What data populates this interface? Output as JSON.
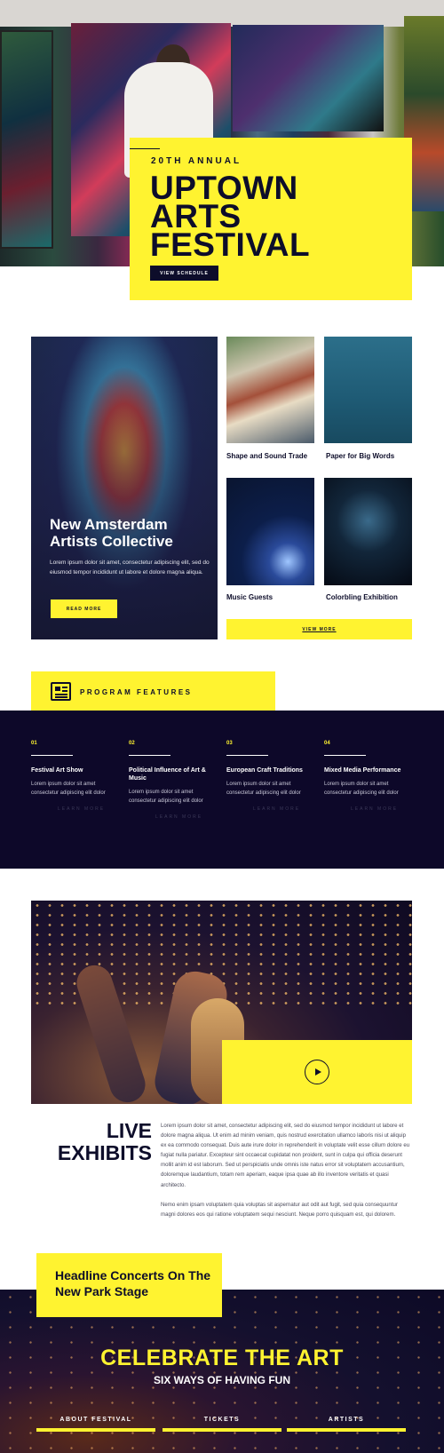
{
  "hero": {
    "kicker": "20TH ANNUAL",
    "title": "UPTOWN ARTS FESTIVAL",
    "cta": "VIEW SCHEDULE"
  },
  "gallery": {
    "feature": {
      "title": "New Amsterdam Artists Collective",
      "text": "Lorem ipsum dolor sit amet, consectetur adipiscing elit, sed do eiusmod tempor incididunt ut labore et dolore magna aliqua.",
      "cta": "READ MORE"
    },
    "items": [
      {
        "caption": "Shape and Sound Trade"
      },
      {
        "caption": "Paper for Big Words"
      },
      {
        "caption": "Music Guests"
      },
      {
        "caption": "Colorbling Exhibition"
      }
    ],
    "more": "VIEW MORE"
  },
  "program": {
    "label": "PROGRAM FEATURES",
    "features": [
      {
        "num": "01",
        "title": "Festival Art Show",
        "text": "Lorem ipsum dolor sit amet consectetur adipiscing elit dolor",
        "more": "LEARN MORE"
      },
      {
        "num": "02",
        "title": "Political Influence of Art & Music",
        "text": "Lorem ipsum dolor sit amet consectetur adipiscing elit dolor",
        "more": "LEARN MORE"
      },
      {
        "num": "03",
        "title": "European Craft Traditions",
        "text": "Lorem ipsum dolor sit amet consectetur adipiscing elit dolor",
        "more": "LEARN MORE"
      },
      {
        "num": "04",
        "title": "Mixed Media Performance",
        "text": "Lorem ipsum dolor sit amet consectetur adipiscing elit dolor",
        "more": "LEARN MORE"
      }
    ]
  },
  "live": {
    "title": "LIVE EXHIBITS",
    "p1": "Lorem ipsum dolor sit amet, consectetur adipiscing elit, sed do eiusmod tempor incididunt ut labore et dolore magna aliqua. Ut enim ad minim veniam, quis nostrud exercitation ullamco laboris nisi ut aliquip ex ea commodo consequat. Duis aute irure dolor in reprehenderit in voluptate velit esse cillum dolore eu fugiat nulla pariatur. Excepteur sint occaecat cupidatat non proident, sunt in culpa qui officia deserunt mollit anim id est laborum. Sed ut perspiciatis unde omnis iste natus error sit voluptatem accusantium, doloremque laudantium, totam rem aperiam, eaque ipsa quae ab illo inventore veritatis et quasi architecto.",
    "p2": "Nemo enim ipsam voluptatem quia voluptas sit aspernatur aut odit aut fugit, sed quia consequuntur magni dolores eos qui ratione voluptatem sequi nesciunt. Neque porro quisquam est, qui dolorem."
  },
  "concerts": {
    "title": "Headline Concerts On The New Park Stage",
    "celebrate": "CELEBRATE THE ART",
    "subtitle": "SIX WAYS OF HAVING FUN",
    "nav": [
      "ABOUT FESTIVAL",
      "TICKETS",
      "ARTISTS"
    ]
  },
  "colors": {
    "accent": "#fff330",
    "navy": "#0d0829"
  }
}
